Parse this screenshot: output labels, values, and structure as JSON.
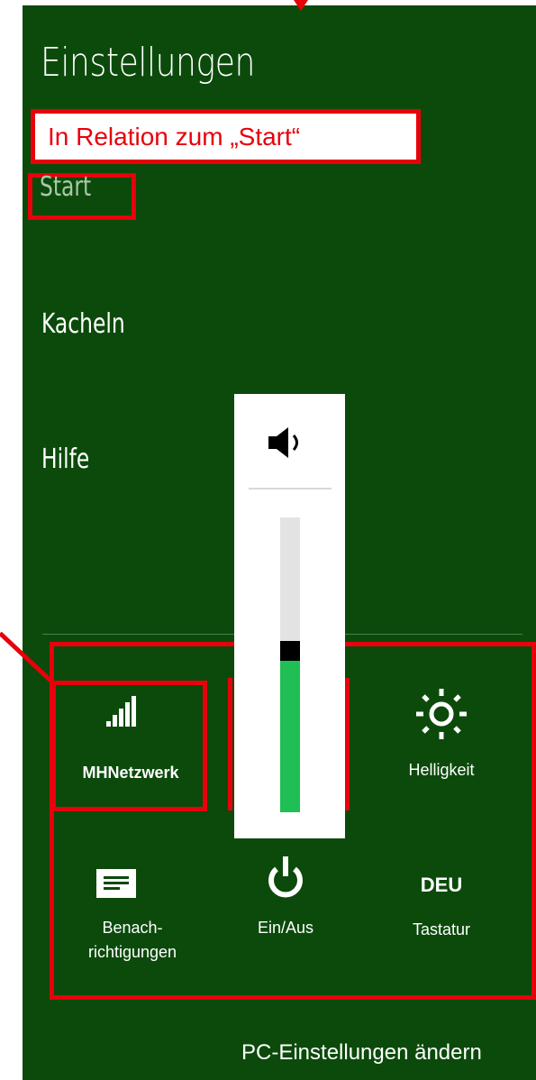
{
  "settings_pane": {
    "title": "Einstellungen",
    "annotation": "In Relation zum „Start“",
    "menu": {
      "start": "Start",
      "tiles": "Kacheln",
      "help": "Hilfe"
    },
    "quick_settings": {
      "network_label": "MHNetzwerk",
      "brightness_label": "Helligkeit",
      "notifications_label_line1": "Benach-",
      "notifications_label_line2": "richtigungen",
      "power_label": "Ein/Aus",
      "keyboard_code": "DEU",
      "keyboard_label": "Tastatur"
    },
    "volume": {
      "level_fraction": 0.55,
      "icon": "speaker-icon"
    },
    "footer_link": "PC-Einstellungen ändern"
  },
  "colors": {
    "panel_bg": "#0b4a0b",
    "annotation_red": "#e8000b",
    "volume_fill": "#1fbf55"
  }
}
